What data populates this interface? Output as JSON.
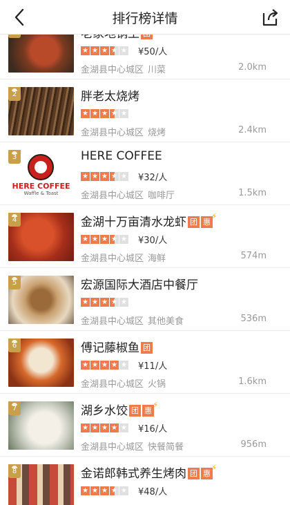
{
  "header": {
    "title": "排行榜详情",
    "back_icon": "back-arrow-icon",
    "share_icon": "share-icon"
  },
  "colors": {
    "accent": "#ef7b4c",
    "rank_badge": "#c8a04a",
    "star_empty": "#e0e0e0",
    "meta_text": "#999999"
  },
  "items": [
    {
      "rank": "",
      "name": "老家地锅王",
      "rating": 3.5,
      "price": "¥50/人",
      "area": "金湖县中心城区",
      "category": "川菜",
      "distance": "2.0km",
      "badges": [
        "团"
      ],
      "bolt": false
    },
    {
      "rank": "2",
      "name": "胖老太烧烤",
      "rating": 3.5,
      "price": "",
      "area": "金湖县中心城区",
      "category": "烧烤",
      "distance": "2.4km",
      "badges": [],
      "bolt": false
    },
    {
      "rank": "3",
      "name": "HERE COFFEE",
      "rating": 3.5,
      "price": "¥32/人",
      "area": "金湖县中心城区",
      "category": "咖啡厅",
      "distance": "1.5km",
      "badges": [],
      "bolt": false,
      "logo_text": "HERE COFFEE",
      "logo_sub": "Waffle & Toast"
    },
    {
      "rank": "4",
      "name": "金湖十万亩清水龙虾",
      "rating": 3.5,
      "price": "¥30/人",
      "area": "金湖县中心城区",
      "category": "海鲜",
      "distance": "574m",
      "badges": [
        "团",
        "惠"
      ],
      "bolt": true
    },
    {
      "rank": "5",
      "name": "宏源国际大酒店中餐厅",
      "rating": 3.5,
      "price": "",
      "area": "金湖县中心城区",
      "category": "其他美食",
      "distance": "536m",
      "badges": [],
      "bolt": false
    },
    {
      "rank": "6",
      "name": "傅记藤椒鱼",
      "rating": 4,
      "price": "¥11/人",
      "area": "金湖县中心城区",
      "category": "火锅",
      "distance": "1.6km",
      "badges": [
        "团"
      ],
      "bolt": false
    },
    {
      "rank": "7",
      "name": "湖乡水饺",
      "rating": 4,
      "price": "¥16/人",
      "area": "金湖县中心城区",
      "category": "快餐简餐",
      "distance": "956m",
      "badges": [
        "团",
        "惠"
      ],
      "bolt": true
    },
    {
      "rank": "8",
      "name": "金诺郎韩式养生烤肉",
      "rating": 3.5,
      "price": "¥48/人",
      "area": "",
      "category": "",
      "distance": "",
      "badges": [
        "团",
        "惠"
      ],
      "bolt": true
    }
  ]
}
